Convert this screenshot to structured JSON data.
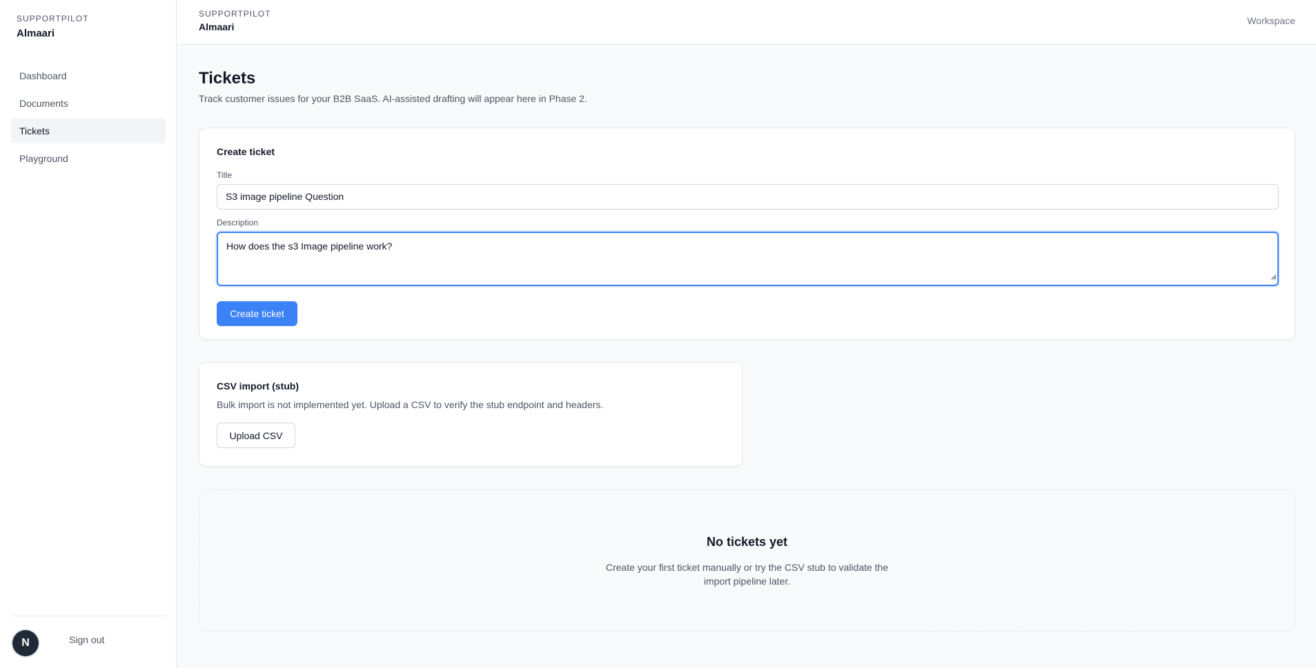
{
  "sidebar": {
    "brand_kicker": "SUPPORTPILOT",
    "brand_name": "Almaari",
    "items": [
      {
        "label": "Dashboard",
        "active": false
      },
      {
        "label": "Documents",
        "active": false
      },
      {
        "label": "Tickets",
        "active": true
      },
      {
        "label": "Playground",
        "active": false
      }
    ],
    "avatar_letter": "N",
    "signout_label": "Sign out"
  },
  "topbar": {
    "brand_kicker": "SUPPORTPILOT",
    "brand_name": "Almaari",
    "right_label": "Workspace"
  },
  "page": {
    "title": "Tickets",
    "subtitle": "Track customer issues for your B2B SaaS. AI-assisted drafting will appear here in Phase 2."
  },
  "create_ticket": {
    "card_title": "Create ticket",
    "title_label": "Title",
    "title_value": "S3 image pipeline Question",
    "description_label": "Description",
    "description_value": "How does the s3 Image pipeline work?",
    "submit_label": "Create ticket"
  },
  "csv_import": {
    "card_title": "CSV import (stub)",
    "description": "Bulk import is not implemented yet. Upload a CSV to verify the stub endpoint and headers.",
    "button_label": "Upload CSV"
  },
  "empty_state": {
    "title": "No tickets yet",
    "description": "Create your first ticket manually or try the CSV stub to validate the import pipeline later."
  },
  "colors": {
    "accent": "#3b82f6",
    "sidebar_active_bg": "#f3f4f6",
    "page_bg": "#f9fafb"
  }
}
